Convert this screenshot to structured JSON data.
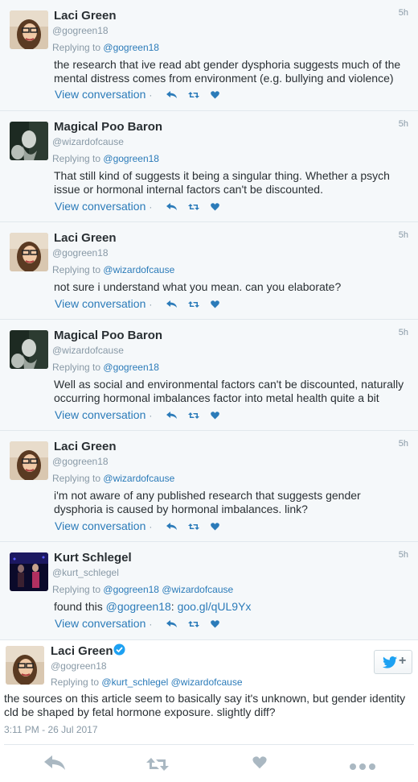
{
  "tweets": [
    {
      "name": "Laci Green",
      "handle": "@gogreen18",
      "time": "5h",
      "reply_prefix": "Replying to",
      "reply_to": "@gogreen18",
      "text": "the research that ive read abt gender dysphoria suggests much of the mental distress comes from environment (e.g. bullying and violence)",
      "view": "View conversation"
    },
    {
      "name": "Magical Poo Baron",
      "handle": "@wizardofcause",
      "time": "5h",
      "reply_prefix": "Replying to",
      "reply_to": "@gogreen18",
      "text": "That still kind of suggests it being a singular thing. Whether a psych issue or hormonal internal factors can't be discounted.",
      "view": "View conversation"
    },
    {
      "name": "Laci Green",
      "handle": "@gogreen18",
      "time": "5h",
      "reply_prefix": "Replying to",
      "reply_to": "@wizardofcause",
      "text": "not sure i understand what you mean. can you elaborate?",
      "view": "View conversation"
    },
    {
      "name": "Magical Poo Baron",
      "handle": "@wizardofcause",
      "time": "5h",
      "reply_prefix": "Replying to",
      "reply_to": "@gogreen18",
      "text": "Well as social and environmental factors can't be discounted, naturally occurring hormonal imbalances factor into metal health quite a bit",
      "view": "View conversation"
    },
    {
      "name": "Laci Green",
      "handle": "@gogreen18",
      "time": "5h",
      "reply_prefix": "Replying to",
      "reply_to": "@wizardofcause",
      "text": "i'm not aware of any published research that suggests gender dysphoria is caused by hormonal imbalances. link?",
      "view": "View conversation"
    },
    {
      "name": "Kurt Schlegel",
      "handle": "@kurt_schlegel",
      "time": "5h",
      "reply_prefix": "Replying to",
      "reply_to": "@gogreen18",
      "reply_to_2": "@wizardofcause",
      "text_prefix": "found this",
      "text_mention": "@gogreen18",
      "text_colon": ":",
      "text_link": "goo.gl/qUL9Yx",
      "view": "View conversation"
    }
  ],
  "main": {
    "name": "Laci Green",
    "handle": "@gogreen18",
    "reply_prefix": "Replying to",
    "reply_to": "@kurt_schlegel",
    "reply_to_2": "@wizardofcause",
    "text": "the sources on this article seem to basically say it's unknown, but gender identity cld be shaped by fetal hormone exposure. slightly diff?",
    "timestamp": "3:11 PM - 26 Jul 2017"
  },
  "icons": {
    "reply": "reply-icon",
    "retweet": "retweet-icon",
    "like": "heart-icon",
    "more": "more-icon",
    "twitter": "twitter-bird-icon",
    "verified": "verified-badge-icon"
  },
  "colors": {
    "link": "#2b7bb9",
    "muted": "#8899a6",
    "text": "#292f33",
    "bg": "#f5f8fa"
  }
}
